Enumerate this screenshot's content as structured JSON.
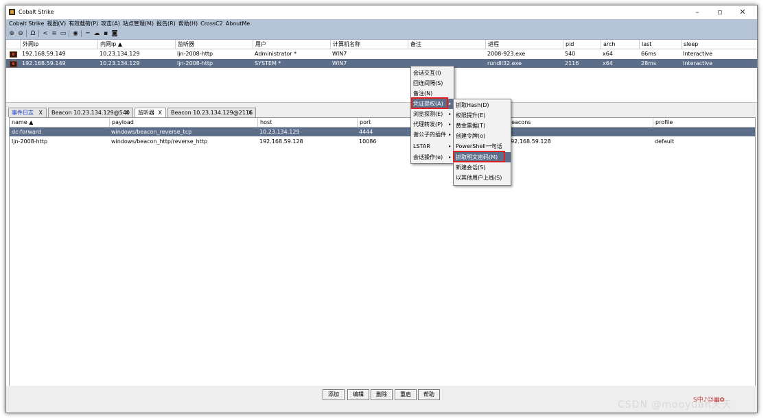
{
  "window": {
    "title": "Cobalt Strike",
    "minimize": "–",
    "restore": "▫",
    "close": "✕"
  },
  "menu": [
    "Cobalt Strike",
    "视图(V)",
    "有效载荷(P)",
    "攻击(A)",
    "站点管理(M)",
    "报告(R)",
    "帮助(H)",
    "CrossC2",
    "AboutMe"
  ],
  "toolbar_icons": [
    "plus-circle-icon",
    "minus-circle-icon",
    "headphones-icon",
    "share-icon",
    "list-icon",
    "monitor-icon",
    "globe-icon",
    "keys-icon",
    "cloud-icon",
    "image-icon",
    "camera-icon"
  ],
  "sessions": {
    "columns": [
      "外网ip",
      "内网ip ▲",
      "监听器",
      "用户",
      "计算机名称",
      "备注",
      "进程",
      "pid",
      "arch",
      "last",
      "sleep"
    ],
    "rows": [
      {
        "external": "192.168.59.149",
        "internal": "10.23.134.129",
        "listener": "ljn-2008-http",
        "user": "Administrator *",
        "computer": "WIN7",
        "note": "",
        "process": "2008-923.exe",
        "pid": "540",
        "arch": "x64",
        "last": "66ms",
        "sleep": "Interactive"
      },
      {
        "external": "192.168.59.149",
        "internal": "10.23.134.129",
        "listener": "ljn-2008-http",
        "user": "SYSTEM *",
        "computer": "WIN7",
        "note": "",
        "process": "rundll32.exe",
        "pid": "2116",
        "arch": "x64",
        "last": "28ms",
        "sleep": "Interactive"
      }
    ]
  },
  "tabs": [
    {
      "label": "事件日志",
      "close": "X"
    },
    {
      "label": "Beacon 10.23.134.129@540",
      "close": "X"
    },
    {
      "label": "监听器",
      "close": "X"
    },
    {
      "label": "Beacon 10.23.134.129@2116",
      "close": "X"
    }
  ],
  "listeners": {
    "columns": [
      "name ▲",
      "payload",
      "host",
      "port",
      "beacons",
      "profile"
    ],
    "rows": [
      {
        "name": "dc-forward",
        "payload": "windows/beacon_reverse_tcp",
        "host": "10.23.134.129",
        "port": "4444",
        "beacons": "",
        "profile": ""
      },
      {
        "name": "ljn-2008-http",
        "payload": "windows/beacon_http/reverse_http",
        "host": "192.168.59.128",
        "port": "10086",
        "beacons": "192.168.59.128",
        "profile": "default"
      }
    ]
  },
  "buttons": [
    "添加",
    "编辑",
    "删除",
    "重启",
    "帮助"
  ],
  "context_menu": [
    "会话交互(I)",
    "回连间隔(S)",
    "备注(N)",
    "凭证提权(A)",
    "浏览探测(E)",
    "代理转发(P)",
    "谢公子的插件",
    "LSTAR",
    "会话操作(e)"
  ],
  "submenu": [
    "抓取Hash(D)",
    "权限提升(E)",
    "黄金票据(T)",
    "创建令牌(o)",
    "PowerShell一句话(O)",
    "抓取明文密码(M)",
    "新建会话(S)",
    "以其他用户上线(S)"
  ],
  "watermark": "CSDN @mooyuan天天"
}
